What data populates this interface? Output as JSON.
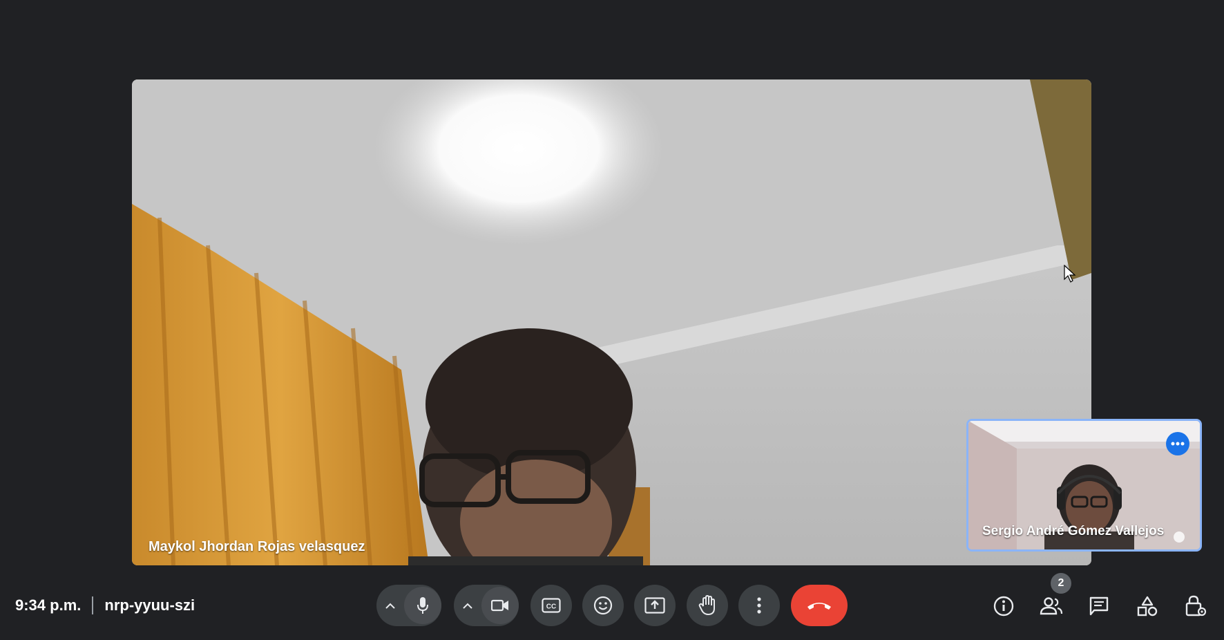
{
  "meeting": {
    "time": "9:34 p.m.",
    "code": "nrp-yyuu-szi"
  },
  "main_participant": {
    "name": "Maykol Jhordan Rojas velasquez"
  },
  "self_view": {
    "name": "Sergio André Gómez Vallejos"
  },
  "controls": {
    "mic": "microphone-icon",
    "camera": "camera-icon",
    "captions": "closed-captions-icon",
    "reactions": "emoji-icon",
    "present": "present-screen-icon",
    "raise_hand": "hand-icon",
    "more": "more-vert-icon",
    "end_call": "end-call-icon",
    "end_call_color": "#ea4335"
  },
  "side_panel": {
    "participants_count": "2",
    "icons": [
      "info-icon",
      "people-icon",
      "chat-icon",
      "activities-icon",
      "host-controls-icon"
    ]
  },
  "accent_color": "#8ab4f8"
}
